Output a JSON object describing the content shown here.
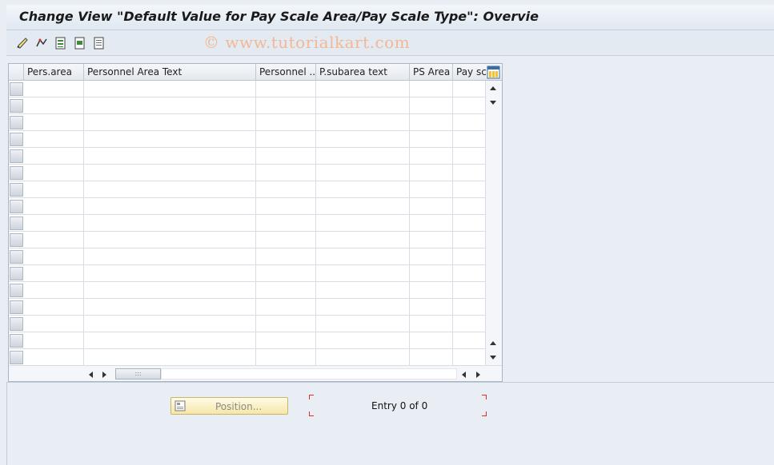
{
  "window": {
    "title": "Change View \"Default Value for Pay Scale Area/Pay Scale Type\": Overvie"
  },
  "toolbar": {
    "watermark": "© www.tutorialkart.com",
    "icons": [
      "display-change-icon",
      "other-entry-icon",
      "select-all-icon",
      "select-block-icon",
      "deselect-all-icon"
    ]
  },
  "grid": {
    "columns": [
      {
        "label": "Pers.area"
      },
      {
        "label": "Personnel Area Text"
      },
      {
        "label": "Personnel ..."
      },
      {
        "label": "P.subarea text"
      },
      {
        "label": "PS Area"
      },
      {
        "label": "Pay sca"
      }
    ],
    "row_count": 17
  },
  "footer": {
    "position_button": "Position...",
    "entry_text": "Entry 0 of 0"
  },
  "colors": {
    "accent_red": "#d9302f",
    "button_yellow": "#f6e7a7",
    "background": "#e9eef4"
  }
}
